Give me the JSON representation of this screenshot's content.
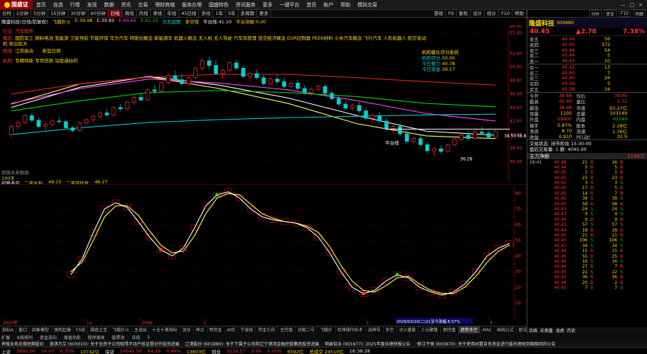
{
  "app": {
    "name": "国盛证",
    "window_controls": [
      "—",
      "□",
      "×"
    ]
  },
  "menu": [
    "首页",
    "自选",
    "行情",
    "发现",
    "数据",
    "资讯",
    "交易",
    "理财商城",
    "服务办理",
    "国盛特色",
    "资讯服务",
    "更多",
    "一键平台",
    "首页",
    "帐户",
    "帮助",
    "模拟交易"
  ],
  "tabs": {
    "items": [
      "分时",
      "1分钟",
      "5分钟",
      "15分钟",
      "30分钟",
      "60分钟",
      "日线",
      "周线",
      "月线",
      "季线",
      "年线",
      "45日线",
      "多线",
      "1年",
      "5年",
      "多周期",
      "更多"
    ],
    "active": 6,
    "right": [
      "冒收",
      "F9",
      "复权",
      "设计",
      "统计",
      "F10",
      "帮助"
    ]
  },
  "title_row": {
    "prefix": "隆盛科技(日线/前复权)",
    "ma_label": "飞蛾扑火",
    "items": [
      {
        "t": "E:39.48",
        "c": "yellow"
      },
      {
        "t": "E:39.80",
        "c": "white"
      },
      {
        "t": "E:40.65",
        "c": "magenta"
      },
      {
        "t": "E:41.10",
        "c": "green"
      },
      {
        "t": "去反超图",
        "c": "cyan"
      },
      {
        "t": "多空线",
        "c": "yellow"
      },
      {
        "t": "平台线:41.10",
        "c": "white"
      },
      {
        "t": "平台突破:0.00",
        "c": "yellow"
      }
    ]
  },
  "annotations": {
    "industry_label": "行业:",
    "industry_value": "汽车配件",
    "concept_label": "概念:",
    "concepts": "国防军工 燃料电池 氢能源 卫星导航 节能环保 华为汽车 特斯拉概念 新能源车 机器人概念 无人机 无人驾驶 汽车热管理 低空经济概念 EGR控制器 PEEK材料 小米汽车概念 飞行汽车 人形机器人 航空发动机 商业航天",
    "region_label": "地域:",
    "region_value": "江苏板块",
    "tags": "新型日频",
    "theme_label": "机构:",
    "theme_value": "专精特新 专项贷款 深股通标的",
    "score_title": "机构健化评分系统",
    "score_items": [
      {
        "label": "机构评分:",
        "value": "50.00"
      },
      {
        "label": "今日做力:",
        "value": "40.78"
      },
      {
        "label": "今日资金:",
        "value": "39.17"
      }
    ],
    "watermark": "跟随未来数据",
    "pct_label": "100天"
  },
  "main_chart": {
    "ymin": 33,
    "ymax": 56,
    "y_ticks": [
      56,
      55,
      52,
      50,
      48,
      46,
      44,
      42,
      40,
      38,
      36
    ],
    "candles": [
      [
        40,
        41.5,
        39.6,
        41.2
      ],
      [
        41.2,
        42,
        40.8,
        41.8
      ],
      [
        41.8,
        43,
        41.5,
        42.8
      ],
      [
        42.8,
        43.2,
        41.9,
        42.1
      ],
      [
        42.1,
        42.5,
        40.9,
        41.2
      ],
      [
        41.2,
        41.8,
        40.5,
        41.5
      ],
      [
        41.5,
        42.3,
        41.2,
        42
      ],
      [
        42,
        42.6,
        41.6,
        41.9
      ],
      [
        41.9,
        42.2,
        40.8,
        41
      ],
      [
        41,
        41.3,
        40.3,
        40.6
      ],
      [
        40.6,
        41.9,
        40.4,
        41.7
      ],
      [
        41.7,
        42.4,
        41.3,
        42.2
      ],
      [
        42.2,
        42.9,
        41.8,
        42.7
      ],
      [
        42.7,
        43.5,
        42.4,
        43.2
      ],
      [
        43.2,
        43.8,
        42.6,
        42.9
      ],
      [
        42.9,
        44.2,
        42.7,
        44
      ],
      [
        44,
        44.5,
        43.4,
        43.8
      ],
      [
        43.8,
        45,
        43.6,
        44.8
      ],
      [
        44.8,
        45.8,
        44.4,
        45.5
      ],
      [
        45.5,
        46.2,
        44.9,
        45.1
      ],
      [
        45.1,
        46.8,
        45,
        46.6
      ],
      [
        46.6,
        47.3,
        46,
        46.4
      ],
      [
        46.4,
        47.9,
        46.2,
        47.7
      ],
      [
        47.7,
        49,
        47.4,
        48.7
      ],
      [
        48.7,
        49.5,
        47.8,
        48.1
      ],
      [
        48.1,
        48.9,
        47.2,
        47.5
      ],
      [
        47.5,
        48.6,
        47.2,
        48.4
      ],
      [
        48.4,
        50,
        48.2,
        49.8
      ],
      [
        49.8,
        51.2,
        49.4,
        50.9
      ],
      [
        50.9,
        51.5,
        49.9,
        50.2
      ],
      [
        50.2,
        51,
        48.8,
        49
      ],
      [
        49,
        49.8,
        48.2,
        49.5
      ],
      [
        49.5,
        50.8,
        49.3,
        50.6
      ],
      [
        50.6,
        51,
        49.5,
        49.8
      ],
      [
        49.8,
        50.2,
        48.3,
        48.6
      ],
      [
        48.6,
        49.3,
        47.8,
        49
      ],
      [
        49,
        49.6,
        48.1,
        48.4
      ],
      [
        48.4,
        48.8,
        47.2,
        47.5
      ],
      [
        47.5,
        48.5,
        47.3,
        48.2
      ],
      [
        48.2,
        48.9,
        47.5,
        47.8
      ],
      [
        47.8,
        48.3,
        46.8,
        47.1
      ],
      [
        47.1,
        47.9,
        46.9,
        47.6
      ],
      [
        47.6,
        48.1,
        46.5,
        46.8
      ],
      [
        46.8,
        47.3,
        45.9,
        46.2
      ],
      [
        46.2,
        47,
        45.8,
        46.7
      ],
      [
        46.7,
        47.4,
        46.3,
        47.1
      ],
      [
        47.1,
        47.5,
        45.8,
        46.1
      ],
      [
        46.1,
        46.6,
        45,
        45.3
      ],
      [
        45.3,
        45.8,
        44.2,
        44.5
      ],
      [
        44.5,
        45,
        43.6,
        43.9
      ],
      [
        43.9,
        44.6,
        43.5,
        44.3
      ],
      [
        44.3,
        44.8,
        43.2,
        43.5
      ],
      [
        43.5,
        43.9,
        42.1,
        42.4
      ],
      [
        42.4,
        43.1,
        41.9,
        42.8
      ],
      [
        42.8,
        43.3,
        41.7,
        42
      ],
      [
        42,
        42.4,
        40.6,
        40.9
      ],
      [
        40.9,
        41.5,
        40.2,
        41.2
      ],
      [
        41.2,
        41.6,
        39.8,
        40.1
      ],
      [
        40.1,
        40.6,
        38.7,
        39
      ],
      [
        39,
        39.7,
        38.5,
        39.4
      ],
      [
        39.4,
        39.9,
        38.2,
        38.5
      ],
      [
        38.5,
        38.9,
        37.3,
        37.6
      ],
      [
        37.6,
        38.2,
        36.8,
        37.9
      ],
      [
        37.9,
        38.4,
        37.2,
        37.5
      ],
      [
        37.5,
        38.7,
        37.3,
        38.5
      ],
      [
        38.5,
        39.6,
        38.3,
        39.3
      ],
      [
        39.3,
        40.2,
        39,
        39.9
      ],
      [
        39.9,
        40.5,
        39.1,
        39.4
      ],
      [
        39.4,
        40.8,
        39.2,
        40.4
      ],
      [
        40.4,
        41.2,
        39.9,
        40.2
      ],
      [
        40.2,
        40.6,
        39.3,
        39.6
      ],
      [
        39.6,
        40.8,
        39.5,
        40.45
      ]
    ],
    "ma_lines": [
      {
        "c": "#ffff66",
        "v": [
          44.5,
          47.5,
          48.5,
          46.8,
          44.6,
          41.6,
          39.8,
          39.4
        ]
      },
      {
        "c": "#ffffff",
        "v": [
          44,
          47,
          48.6,
          47.3,
          45.4,
          42.8,
          40.5,
          39.9
        ]
      },
      {
        "c": "#ff44ff",
        "v": [
          44.6,
          46.8,
          48.2,
          47.6,
          46.6,
          45,
          43.1,
          42
        ]
      },
      {
        "c": "#00dd00",
        "v": [
          43.5,
          45,
          46.2,
          46.5,
          46.2,
          45.6,
          44.6,
          44.1
        ]
      },
      {
        "c": "#dd2222",
        "v": [
          46,
          47.5,
          48.5,
          48.9,
          48.9,
          48.4,
          47.8,
          47.3
        ]
      },
      {
        "c": "#00cccc",
        "v": [
          40,
          41,
          41.8,
          42.2,
          42.5,
          42.7,
          42.9,
          43
        ]
      }
    ],
    "platform_label": "平台线",
    "low_label": "36.28",
    "price_label_1": "38.50",
    "price_label_2": "38.8"
  },
  "osc_panel": {
    "title": "趋势多空",
    "line1_label": "二波主升:",
    "line1_value": "49.15",
    "line2_label": "二波空信号:",
    "line2_value": "46.27",
    "y_ticks": [
      80,
      70,
      60,
      50,
      40,
      30,
      20,
      10
    ],
    "series1": [
      28,
      38,
      55,
      70,
      74,
      71,
      62,
      52,
      44,
      40,
      45,
      58,
      72,
      79,
      81,
      77,
      70,
      65,
      63,
      62,
      61,
      58,
      52,
      42,
      30,
      20,
      16,
      18,
      24,
      28,
      26,
      20,
      17,
      15,
      17,
      22,
      30,
      40,
      45,
      48
    ],
    "series2": [
      30,
      36,
      50,
      65,
      72,
      72,
      66,
      56,
      47,
      42,
      43,
      53,
      67,
      77,
      80,
      79,
      73,
      67,
      64,
      62,
      61,
      59,
      55,
      46,
      34,
      24,
      18,
      17,
      21,
      26,
      27,
      22,
      18,
      16,
      16,
      20,
      27,
      36,
      43,
      47
    ]
  },
  "x_axis": {
    "labels": [
      "2025年",
      "12",
      "2026",
      "2",
      "3",
      "4"
    ],
    "date_label": "2026/03/10(二)21至今涨幅:8.57%"
  },
  "bottom_tabs": {
    "items": [
      "指标A",
      "窗口",
      "四象模型",
      "强势起爆",
      "F5线",
      "操盘之宝",
      "飞蛾扑火",
      "主战出",
      "十全十美指标",
      "加仓",
      "神点",
      "明资金",
      "AI优",
      "宁波线",
      "资金方向",
      "主控盘",
      "动能二号",
      "飞蛾扑",
      "欢神操作技术",
      "战神导",
      "多空",
      "冰火量能",
      "三元聚散",
      "趋控盘",
      "趋势多空",
      "MAC",
      "画线公式",
      "欧式控盘",
      "级面公式",
      "更多"
    ],
    "active": 24
  },
  "func_bar": [
    "扩展",
    "K线排列",
    "资金流向",
    "增值功能",
    "程序接收",
    "股票池",
    "日线",
    "1"
  ],
  "news": [
    "养殖业务支撑短期股价",
    "美琪万立 (603010): 关于全资子公司取得不动产权证暨对外投资进展",
    "辽港股份 (601880): 关于下属子公司和辽宁港湾金融控股集团投资进展",
    "明泰铝业 (601677): 2025年度业绩快报公告",
    "·新江不销 (603870): 关于使用闲置自有资金进行委托理财到期赎回的公告"
  ],
  "status": [
    {
      "t": "上证",
      "c": "white"
    },
    {
      "t": "3995.00",
      "c": "red"
    },
    {
      "t": "14.07",
      "c": "red"
    },
    {
      "t": "0.35%",
      "c": "red"
    },
    {
      "t": "10742亿",
      "c": "yellow"
    },
    {
      "t": "深证",
      "c": "white"
    },
    {
      "t": "14042.50",
      "c": "red"
    },
    {
      "t": "64.29",
      "c": "red"
    },
    {
      "t": "0.46%",
      "c": "red"
    },
    {
      "t": "13603亿",
      "c": "yellow"
    },
    {
      "t": "创业",
      "c": "white"
    },
    {
      "t": "3216.57",
      "c": "red"
    },
    {
      "t": "2.99",
      "c": "red"
    },
    {
      "t": "0.05%",
      "c": "red"
    },
    {
      "t": "6592亿",
      "c": "yellow"
    },
    {
      "t": "总成交 24510亿",
      "c": "yellow"
    },
    {
      "t": "16:38:28",
      "c": "white"
    }
  ],
  "right_panel": {
    "head_tabs": [
      "分时",
      "资金",
      "F10",
      "明细"
    ],
    "stock_name": "隆盛科技",
    "stock_code": "300680",
    "price": "40.45",
    "change": "▲2.78",
    "change_pct": "7.38%",
    "asks": [
      {
        "l": "卖五",
        "p": "40.46",
        "v": "56"
      },
      {
        "l": "卖四",
        "p": "40.45",
        "v": "372"
      },
      {
        "l": "卖三",
        "p": "40.44",
        "v": "54"
      },
      {
        "l": "卖二",
        "p": "40.44",
        "v": "5"
      },
      {
        "l": "卖一",
        "p": "40.43",
        "v": "10"
      }
    ],
    "bids": [
      {
        "l": "买一",
        "p": "40.42",
        "v": "13"
      },
      {
        "l": "买二",
        "p": "40.40",
        "v": "7"
      },
      {
        "l": "买三",
        "p": "40.40",
        "v": "26"
      },
      {
        "l": "买四",
        "p": "40.39",
        "v": "5"
      },
      {
        "l": "买五",
        "p": "40.38",
        "v": "34"
      }
    ],
    "stats": [
      {
        "k1": "今开",
        "v1": "38.88",
        "c1": "red",
        "k2": "均价",
        "v2": "39.80",
        "c2": "red"
      },
      {
        "k1": "最高",
        "v1": "40.49",
        "c1": "red",
        "k2": "量比",
        "v2": "1.72",
        "c2": "red"
      },
      {
        "k1": "最低",
        "v1": "38.88",
        "c1": "red",
        "k2": "市值",
        "v2": "93.27亿",
        "c2": "yellow"
      },
      {
        "k1": "现量",
        "v1": "1105",
        "c1": "yellow",
        "k2": "总量",
        "v2": "103149",
        "c2": "yellow"
      },
      {
        "k1": "外盘",
        "v1": "59900",
        "c1": "red",
        "k2": "内盘",
        "v2": "43249",
        "c2": "green"
      },
      {
        "k1": "换手",
        "v1": "5.87%",
        "c1": "yellow",
        "k2": "股本",
        "v2": "2.28亿",
        "c2": "yellow"
      },
      {
        "k1": "净资",
        "v1": "8.70",
        "c1": "yellow",
        "k2": "流通",
        "v2": "1.76亿",
        "c2": "yellow"
      },
      {
        "k1": "收益",
        "v1": "0.910",
        "c1": "yellow",
        "k2": "PE(动)",
        "v2": "32.9",
        "c2": "yellow"
      }
    ],
    "trade_status": "交易状态: 闭市阶段 15:30:00",
    "after_hours": "盘后交易量: 1 额: 4045.00",
    "net_label": "主力净额",
    "net_value": "1149万",
    "trades": [
      {
        "t": "16:41",
        "p": "40.48",
        "v": "21",
        "d": "B",
        "v2": "16",
        "d2": "B"
      },
      {
        "t": "",
        "p": "40.44",
        "v": "5",
        "d": "B",
        "v2": "5",
        "d2": "B"
      },
      {
        "t": "",
        "p": "40.45",
        "v": "1",
        "d": "B",
        "v2": "1",
        "d2": "B"
      },
      {
        "t": "",
        "p": "40.45",
        "v": "23",
        "d": "B",
        "v2": "23",
        "d2": "B"
      },
      {
        "t": "",
        "p": "40.45",
        "v": "3",
        "d": "S",
        "v2": "3",
        "d2": "S"
      },
      {
        "t": "",
        "p": "40.45",
        "v": "17",
        "d": "B",
        "v2": "5",
        "d2": "B"
      },
      {
        "t": "",
        "p": "40.45",
        "v": "14",
        "d": "B",
        "v2": "7",
        "d2": "B"
      },
      {
        "t": "",
        "p": "40.45",
        "v": "39",
        "d": "S",
        "v2": "39",
        "d2": "S"
      },
      {
        "t": "",
        "p": "40.45",
        "v": "58",
        "d": "B",
        "v2": "58",
        "d2": "B"
      },
      {
        "t": "",
        "p": "40.43",
        "v": "24",
        "d": "S",
        "v2": "24",
        "d2": "S"
      },
      {
        "t": "",
        "p": "40.43",
        "v": "9",
        "d": "S",
        "v2": "9",
        "d2": "S"
      },
      {
        "t": "",
        "p": "40.44",
        "v": "9",
        "d": "B",
        "v2": "9",
        "d2": "B"
      },
      {
        "t": "",
        "p": "40.43",
        "v": "57",
        "d": "S",
        "v2": "57",
        "d2": "S"
      },
      {
        "t": "",
        "p": "40.44",
        "v": "18",
        "d": "B",
        "v2": "18",
        "d2": "B"
      },
      {
        "t": "",
        "p": "40.45",
        "v": "21",
        "d": "B",
        "v2": "21",
        "d2": "B"
      },
      {
        "t": "",
        "p": "40.45",
        "v": "106",
        "d": "S",
        "v2": "106",
        "d2": "S"
      },
      {
        "t": "",
        "p": "40.43",
        "v": "34",
        "d": "S",
        "v2": "34",
        "d2": "S"
      },
      {
        "t": "",
        "p": "40.44",
        "v": "15",
        "d": "B",
        "v2": "15",
        "d2": "B"
      },
      {
        "t": "",
        "p": "40.45",
        "v": "55",
        "d": "B",
        "v2": "25",
        "d2": "B"
      },
      {
        "t": "",
        "p": "40.44",
        "v": "16",
        "d": "S",
        "v2": "16",
        "d2": "S"
      },
      {
        "t": "",
        "p": "40.44",
        "v": "27",
        "d": "B",
        "v2": "7",
        "d2": "B"
      },
      {
        "t": "",
        "p": "40.45",
        "v": "22",
        "d": "S",
        "v2": "22",
        "d2": "S"
      },
      {
        "t": "",
        "p": "40.44",
        "v": "36",
        "d": "B",
        "v2": "36",
        "d2": "B"
      },
      {
        "t": "",
        "p": "40.44",
        "v": "20",
        "d": "B",
        "v2": "2",
        "d2": "B"
      },
      {
        "t": "",
        "p": "40.45",
        "v": "7",
        "d": "S",
        "v2": "7",
        "d2": "S"
      }
    ],
    "foot_tabs": [
      "日线",
      "买卖盘",
      "龙虎",
      "历史"
    ]
  },
  "colors": {
    "up": "#ff3333",
    "down": "#00d0d0",
    "bg": "#000000",
    "grid": "#5a0000"
  }
}
